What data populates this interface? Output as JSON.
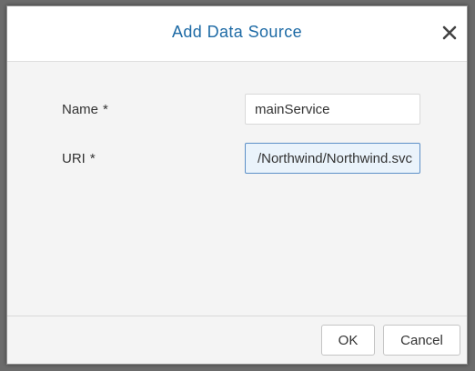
{
  "dialog": {
    "title": "Add Data Source",
    "close_icon": "close-icon"
  },
  "form": {
    "name": {
      "label": "Name",
      "required_marker": "*",
      "value": "mainService"
    },
    "uri": {
      "label": "URI",
      "required_marker": "*",
      "value": "/Northwind/Northwind.svc"
    }
  },
  "footer": {
    "ok_label": "OK",
    "cancel_label": "Cancel"
  },
  "colors": {
    "title": "#1d6aa5",
    "focused_field_bg": "#eaf3fb",
    "focused_field_border": "#5c8fc7"
  }
}
